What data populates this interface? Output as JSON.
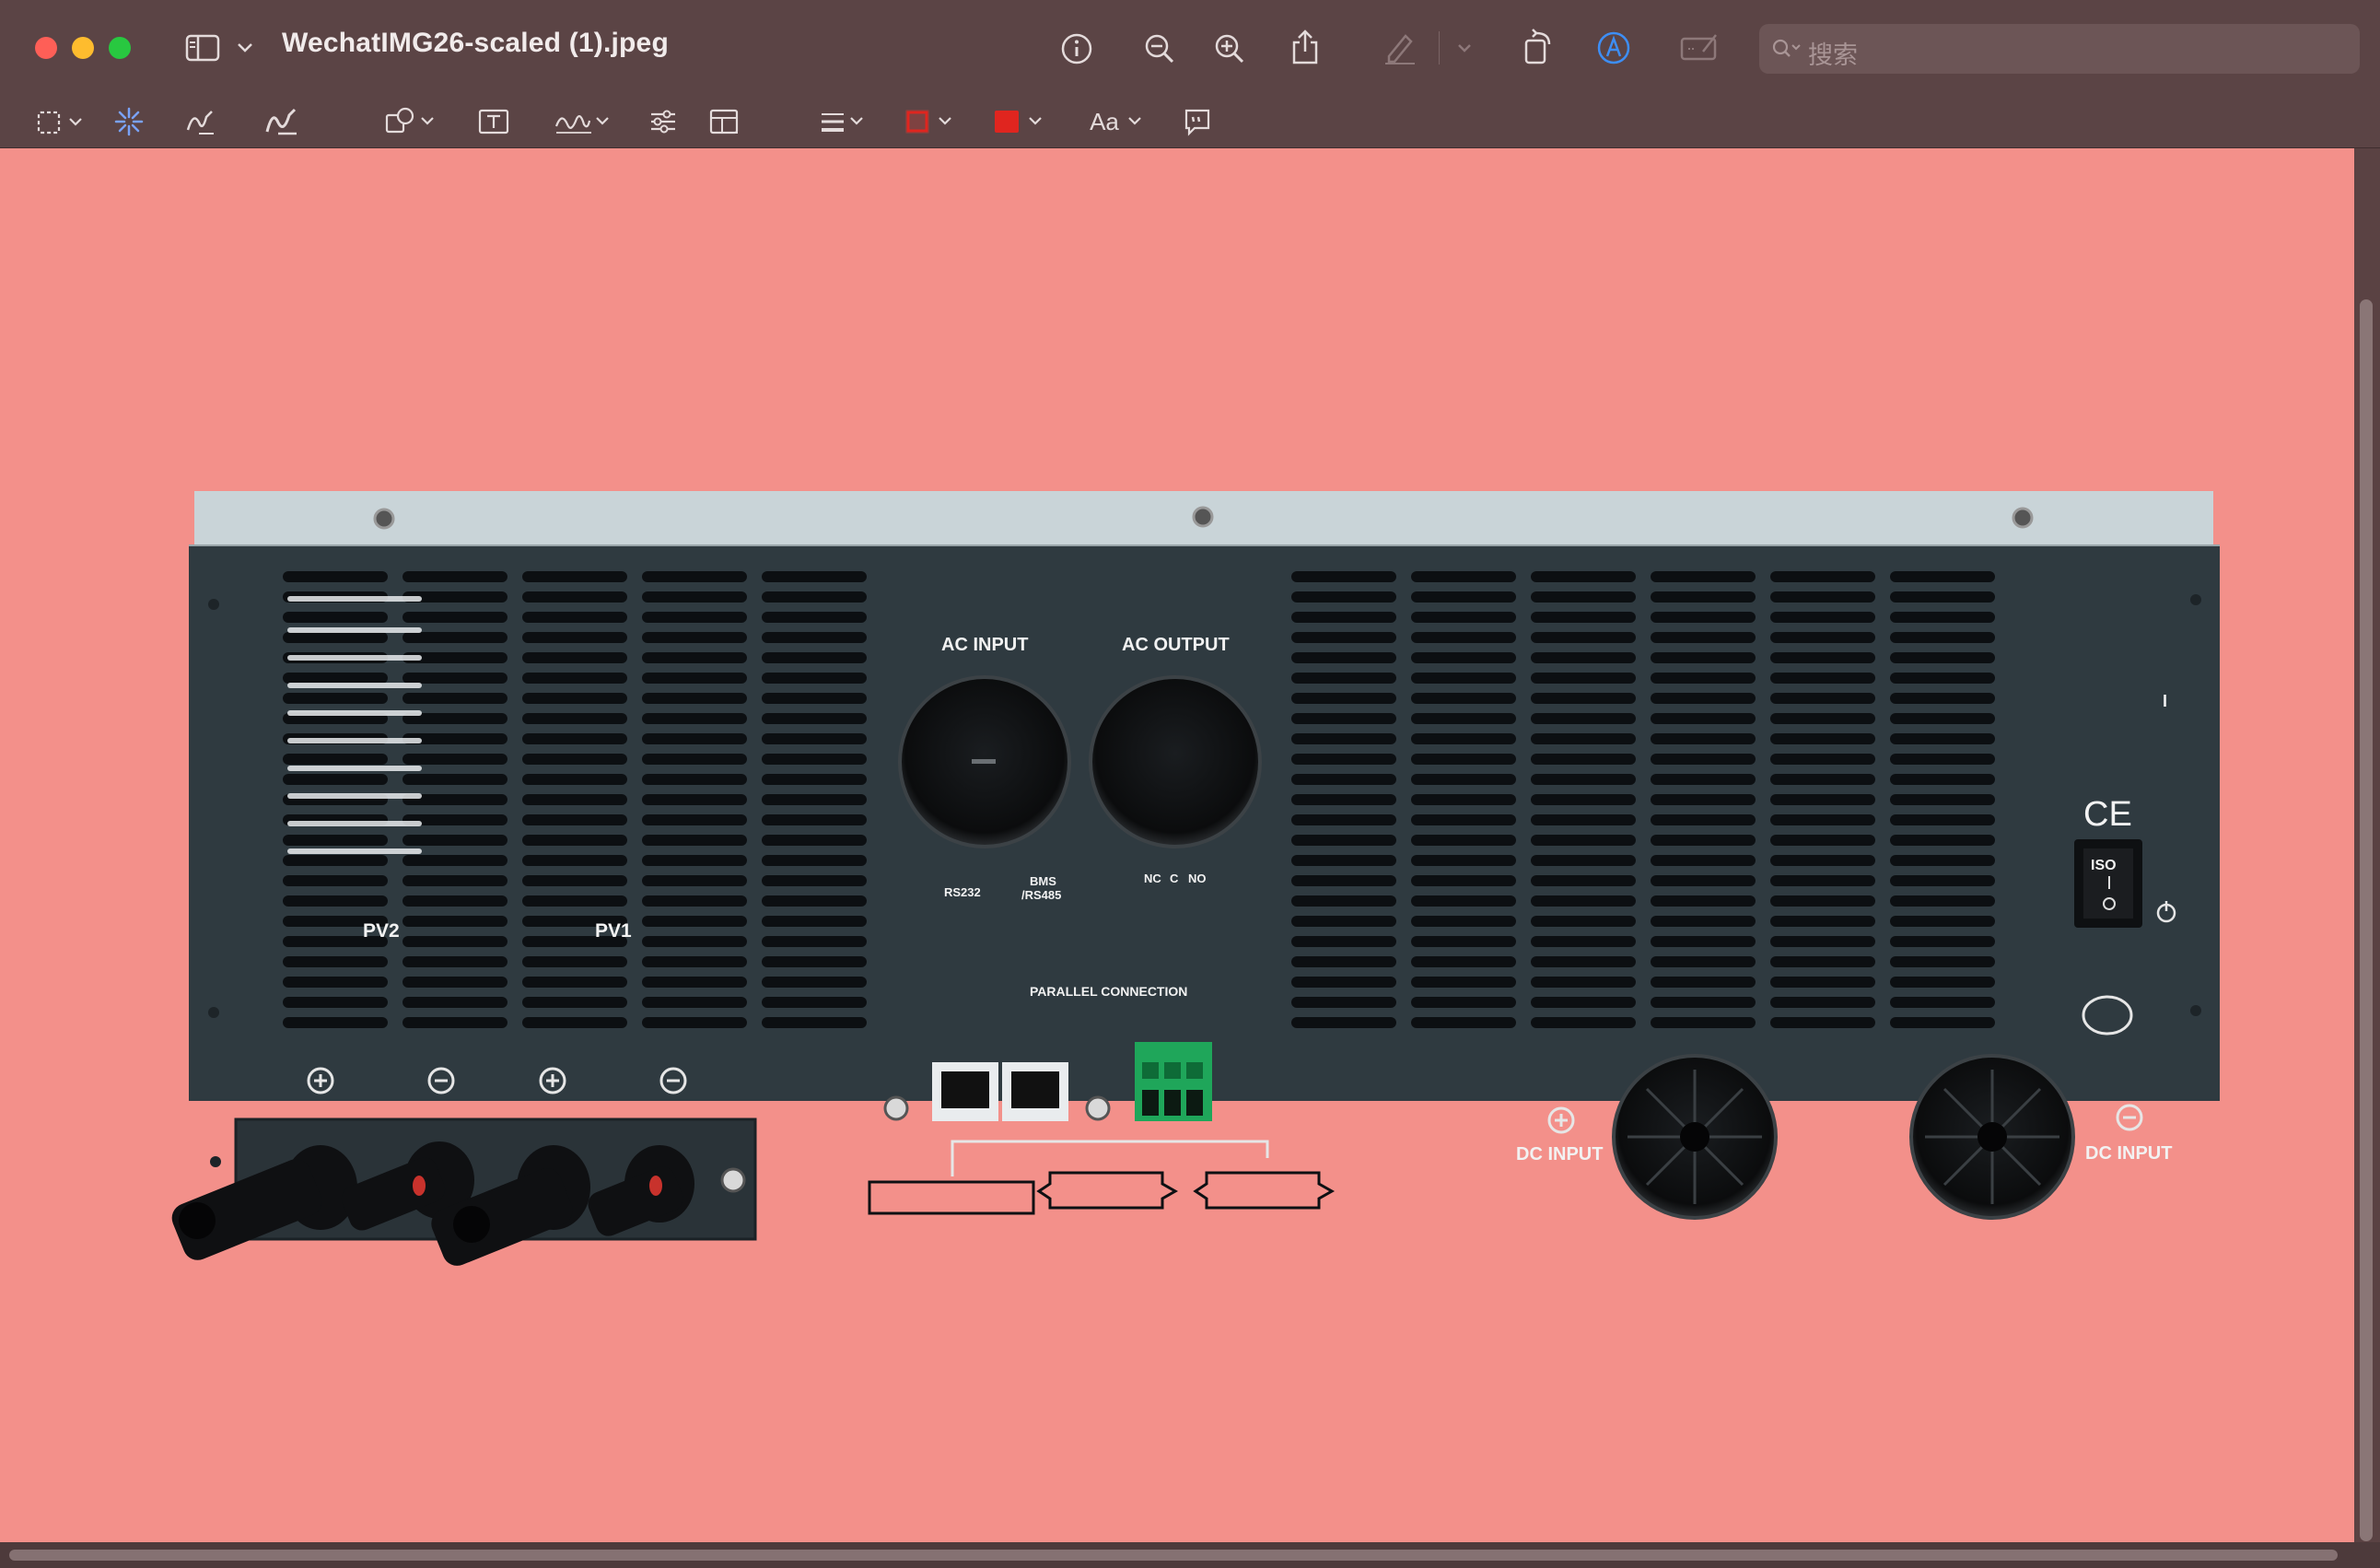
{
  "window": {
    "title": "WechatIMG26-scaled (1).jpeg",
    "search_placeholder": "搜索"
  },
  "toolbar": {
    "top_icons": [
      "sidebar-icon",
      "chevron-down-icon",
      "info-icon",
      "zoom-out-icon",
      "zoom-in-icon",
      "share-icon",
      "highlight-icon",
      "chevron-down-icon",
      "rotate-icon",
      "markup-icon",
      "redact-icon",
      "search-icon"
    ],
    "markup_icons": [
      "rect-select-icon",
      "instant-alpha-icon",
      "sketch-icon",
      "draw-icon",
      "shapes-icon",
      "text-icon",
      "sign-icon",
      "adjust-color-icon",
      "adjust-size-icon",
      "line-style-icon",
      "border-color-icon",
      "fill-color-icon",
      "text-style-icon",
      "note-icon"
    ],
    "border_color": "#e0251f",
    "fill_color": "#e0251f",
    "text_style_label": "Aa"
  },
  "image": {
    "background": "#f3908a",
    "panel_color": "#2f3a40",
    "top_strip_color": "#c9d4d8",
    "labels": {
      "ac_input": "AC INPUT",
      "ac_output": "AC OUTPUT",
      "pv2": "PV2",
      "pv1": "PV1",
      "rs232": "RS232",
      "bms_1": "BMS",
      "bms_2": "/RS485",
      "nc": "NC",
      "c": "C",
      "no": "NO",
      "parallel": "PARALLEL CONNECTION",
      "dc_input_pos": "DC INPUT",
      "dc_input_neg": "DC INPUT",
      "ce": "CE",
      "iso": "ISO",
      "switch_on": "I"
    }
  }
}
